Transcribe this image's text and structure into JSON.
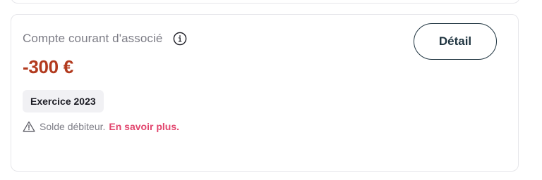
{
  "account_card": {
    "label": "Compte courant d'associé",
    "info_icon": "info-icon",
    "amount": "-300 €",
    "amount_color": "#b23a1e",
    "badge": "Exercice 2023",
    "warning_icon": "warning-triangle-icon",
    "warning_text": "Solde débiteur.",
    "link_text": "En savoir plus.",
    "link_color": "#e2466e",
    "detail_button": "Détail"
  }
}
